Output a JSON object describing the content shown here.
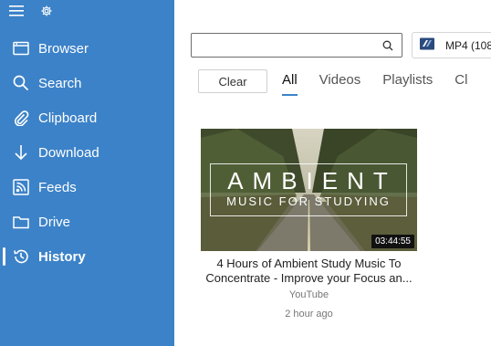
{
  "sidebar": {
    "items": [
      {
        "label": "Browser",
        "icon": "browser-icon"
      },
      {
        "label": "Search",
        "icon": "search-icon"
      },
      {
        "label": "Clipboard",
        "icon": "clipboard-icon"
      },
      {
        "label": "Download",
        "icon": "download-icon"
      },
      {
        "label": "Feeds",
        "icon": "feeds-icon"
      },
      {
        "label": "Drive",
        "icon": "drive-icon"
      },
      {
        "label": "History",
        "icon": "history-icon",
        "active": true
      }
    ],
    "background": "#3c82c8"
  },
  "search": {
    "value": "",
    "placeholder": ""
  },
  "format": {
    "label": "MP4 (108"
  },
  "tabs": {
    "clear_label": "Clear",
    "items": [
      {
        "label": "All",
        "active": true
      },
      {
        "label": "Videos"
      },
      {
        "label": "Playlists"
      },
      {
        "label": "Cl"
      }
    ]
  },
  "history": {
    "items": [
      {
        "thumb_big": "AMBIENT",
        "thumb_small": "MUSIC FOR STUDYING",
        "duration": "03:44:55",
        "title_line1": "4 Hours of Ambient Study Music To",
        "title_line2": "Concentrate - Improve your Focus an...",
        "source": "YouTube",
        "time": "2 hour ago"
      }
    ]
  }
}
